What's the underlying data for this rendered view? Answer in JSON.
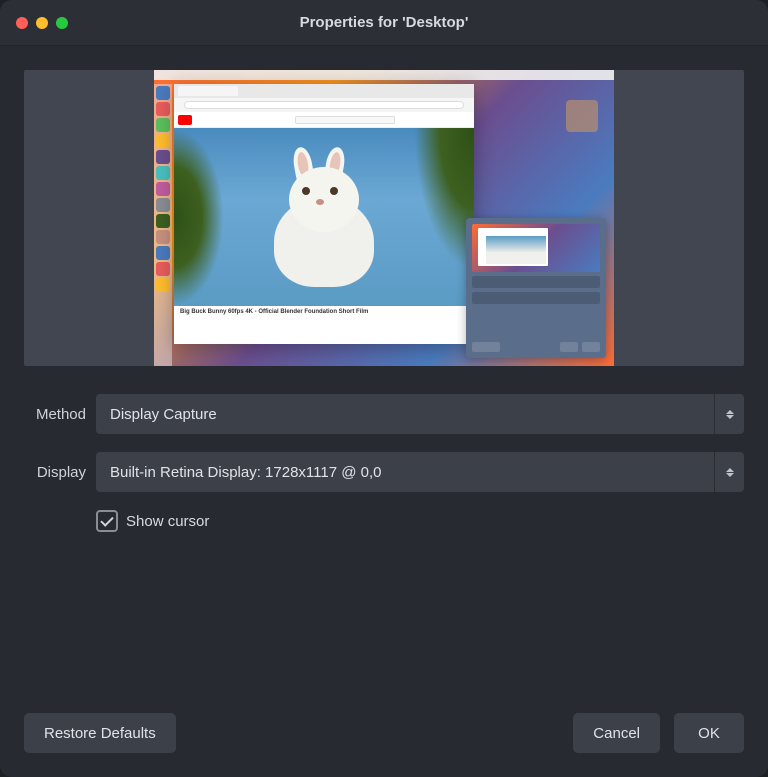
{
  "window": {
    "title": "Properties for 'Desktop'"
  },
  "form": {
    "method": {
      "label": "Method",
      "value": "Display Capture"
    },
    "display": {
      "label": "Display",
      "value": "Built-in Retina Display: 1728x1117 @ 0,0"
    },
    "show_cursor": {
      "label": "Show cursor",
      "checked": true
    }
  },
  "preview": {
    "video_title": "Big Buck Bunny 60fps 4K - Official Blender Foundation Short Film"
  },
  "footer": {
    "restore_defaults": "Restore Defaults",
    "cancel": "Cancel",
    "ok": "OK"
  },
  "colors": {
    "window_bg": "#272a31",
    "titlebar_bg": "#2c2f36",
    "control_bg": "#3c4049",
    "text": "#d8dadf"
  }
}
